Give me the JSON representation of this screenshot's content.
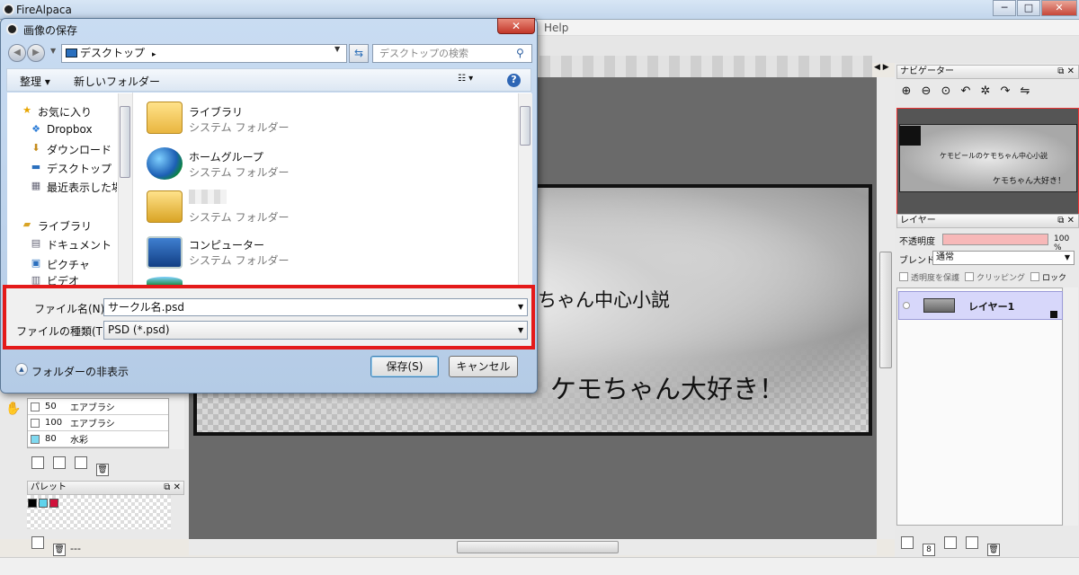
{
  "app": {
    "title": "FireAlpaca",
    "menu_help": "Help"
  },
  "window_buttons": {
    "minimize": "─",
    "maximize": "□",
    "close": "✕"
  },
  "brushes": [
    {
      "size": "50",
      "name": "エアブラシ",
      "color": "#ffffff"
    },
    {
      "size": "100",
      "name": "エアブラシ",
      "color": "#ffffff"
    },
    {
      "size": "80",
      "name": "水彩",
      "color": "#7fd9f0"
    }
  ],
  "palette": {
    "title": "パレット",
    "swatches": [
      "#000000",
      "#5fd3ec",
      "#d0103a"
    ],
    "name": "---"
  },
  "canvas": {
    "text_line1": "ちゃん中心小説",
    "text_line2": "ケモちゃん大好き！"
  },
  "navigator": {
    "title": "ナビゲーター",
    "thumb_line1": "ケモビールのケモちゃん中心小説",
    "thumb_line2": "ケモちゃん大好き！"
  },
  "layers": {
    "title": "レイヤー",
    "opacity_label": "不透明度",
    "opacity_value": "100 %",
    "opacity": 1.0,
    "blend_label": "ブレンド",
    "blend_value": "通常",
    "protect_alpha": "透明度を保護",
    "clipping": "クリッピング",
    "lock": "ロック",
    "items": [
      {
        "name": "レイヤー1"
      }
    ]
  },
  "dialog": {
    "title": "画像の保存",
    "close": "✕",
    "address": "デスクトップ",
    "search_placeholder": "デスクトップの検索",
    "organize": "整理 ▾",
    "new_folder": "新しいフォルダー",
    "tree": {
      "favorites": "お気に入り",
      "dropbox": "Dropbox",
      "downloads": "ダウンロード",
      "desktop": "デスクトップ",
      "recent": "最近表示した場所",
      "libraries": "ライブラリ",
      "documents": "ドキュメント",
      "pictures": "ピクチャ",
      "videos": "ビデオ"
    },
    "files": [
      {
        "name": "ライブラリ",
        "type": "システム フォルダー"
      },
      {
        "name": "ホームグループ",
        "type": "システム フォルダー"
      },
      {
        "name": "",
        "type": "システム フォルダー"
      },
      {
        "name": "コンピューター",
        "type": "システム フォルダー"
      }
    ],
    "filename_label": "ファイル名(N):",
    "filename_value": "サークル名.psd",
    "filetype_label": "ファイルの種類(T):",
    "filetype_value": "PSD (*.psd)",
    "hide_folders": "フォルダーの非表示",
    "save": "保存(S)",
    "cancel": "キャンセル"
  }
}
